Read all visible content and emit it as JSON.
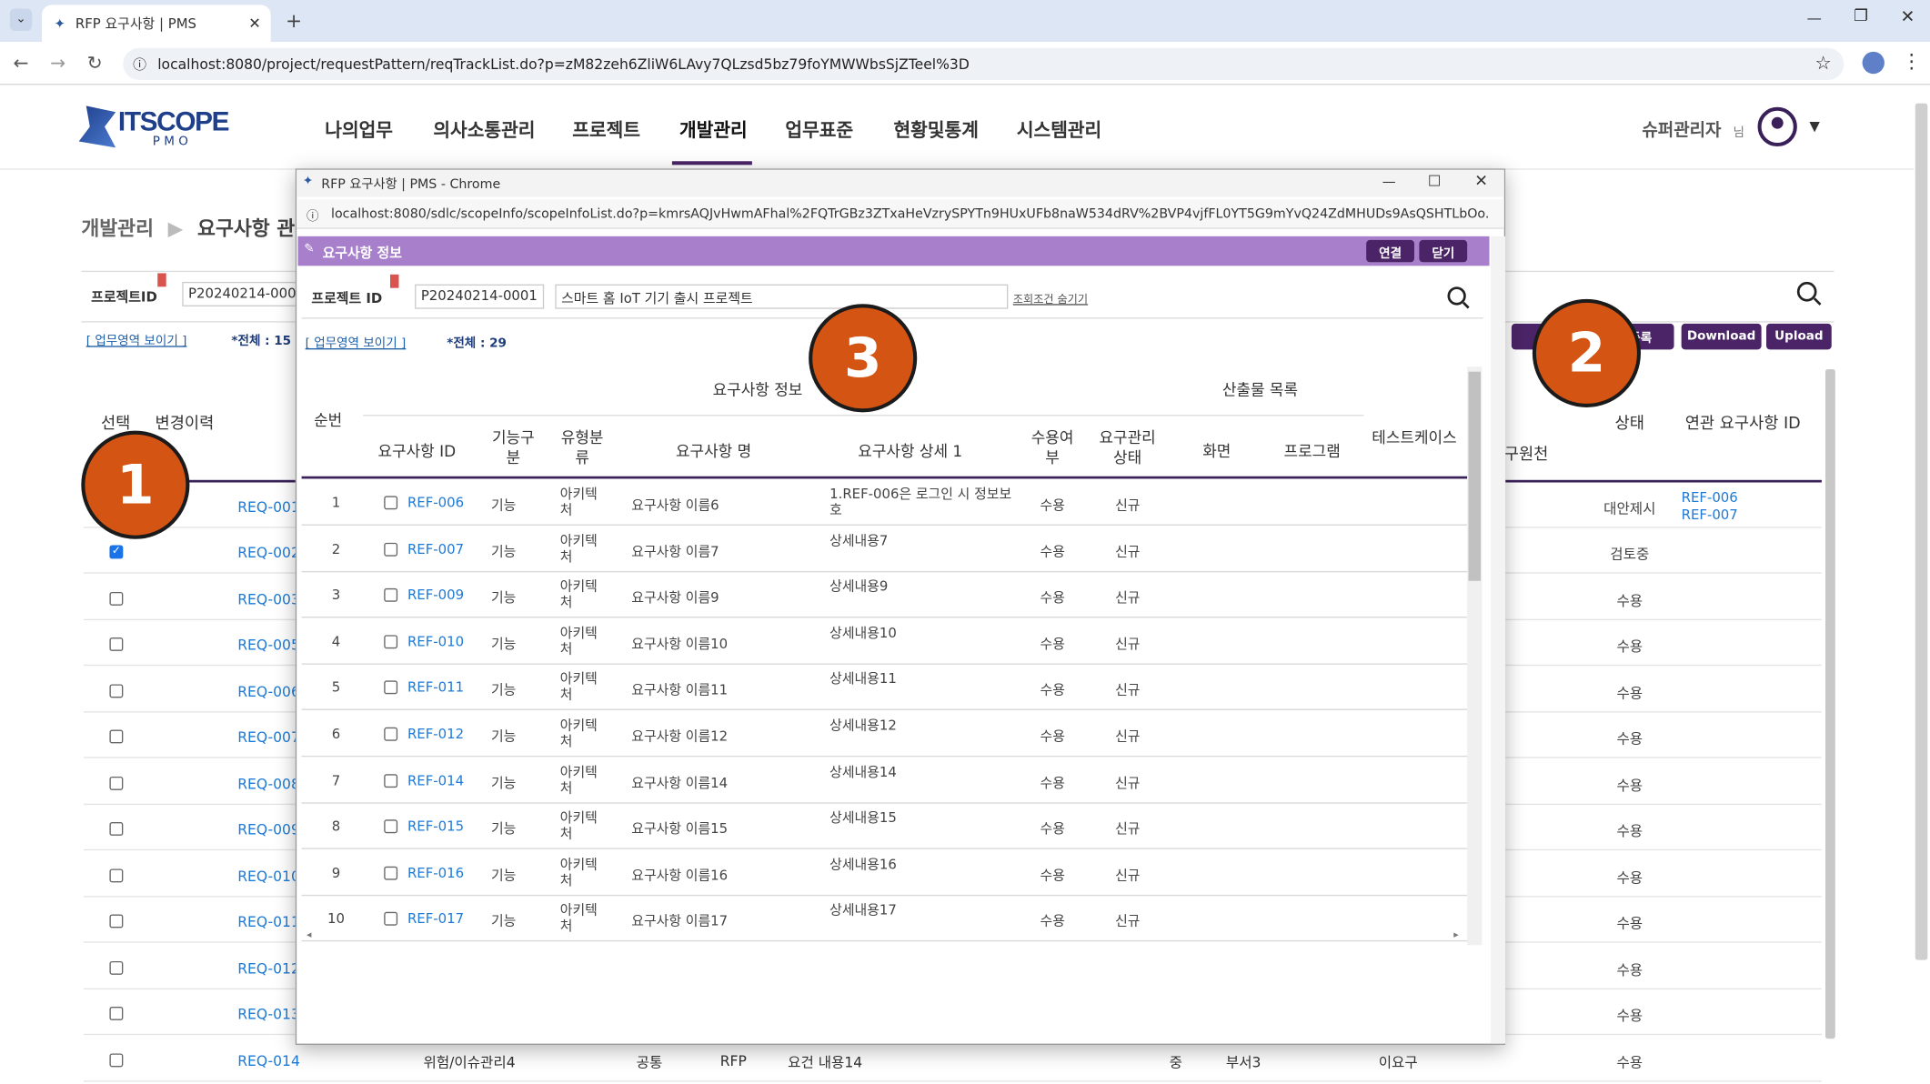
{
  "browser": {
    "tab_title": "RFP 요구사항 | PMS",
    "url": "localhost:8080/project/requestPattern/reqTrackList.do?p=zM82zeh6ZliW6LAvy7QLzsd5bz79foYMWWbsSjZTeel%3D"
  },
  "header": {
    "logo_main": "ITSCOPE",
    "logo_sub": "P M O",
    "menu": [
      "나의업무",
      "의사소통관리",
      "프로젝트",
      "개발관리",
      "업무표준",
      "현황및통계",
      "시스템관리"
    ],
    "user": "슈퍼관리자",
    "user_suffix": "님"
  },
  "page": {
    "breadcrumb_1": "개발관리",
    "breadcrumb_2": "요구사항 관",
    "project_label": "프로젝트ID",
    "project_value": "P20240214-0001",
    "toggle_link": "[ 업무영역 보이기 ]",
    "total": "*전체 : 15",
    "btn_register": "등록",
    "btn_download": "Download",
    "btn_upload": "Upload",
    "col_select": "선택",
    "col_history": "변경이력",
    "col_status": "상태",
    "col_related": "연관 요구사항 ID",
    "col_source": "구원천"
  },
  "rows": [
    {
      "id": "REQ-001",
      "checked": false,
      "status": "대안제시",
      "related": [
        "REF-006",
        "REF-007"
      ]
    },
    {
      "id": "REQ-002",
      "checked": true,
      "status": "검토중",
      "related": []
    },
    {
      "id": "REQ-003",
      "checked": false,
      "status": "수용",
      "related": []
    },
    {
      "id": "REQ-005",
      "checked": false,
      "status": "수용",
      "related": []
    },
    {
      "id": "REQ-006",
      "checked": false,
      "status": "수용",
      "related": []
    },
    {
      "id": "REQ-007",
      "checked": false,
      "status": "수용",
      "related": []
    },
    {
      "id": "REQ-008",
      "checked": false,
      "status": "수용",
      "related": []
    },
    {
      "id": "REQ-009",
      "checked": false,
      "status": "수용",
      "related": []
    },
    {
      "id": "REQ-010",
      "checked": false,
      "status": "수용",
      "related": []
    },
    {
      "id": "REQ-011",
      "checked": false,
      "status": "수용",
      "related": []
    },
    {
      "id": "REQ-012",
      "checked": false,
      "status": "수용",
      "related": []
    },
    {
      "id": "REQ-013",
      "checked": false,
      "status": "수용",
      "related": []
    },
    {
      "id": "REQ-014",
      "checked": false,
      "status": "수용",
      "related": []
    }
  ],
  "last_row": {
    "name": "위험/이슈관리4",
    "type": "공통",
    "source": "RFP",
    "content": "요건 내용14",
    "level": "중",
    "dept": "부서3",
    "owner": "이요구"
  },
  "popup": {
    "title": "RFP 요구사항 | PMS - Chrome",
    "url": "localhost:8080/sdlc/scopeInfo/scopeInfoList.do?p=kmrsAQJvHwmAFhal%2FQTrGBz3ZTxaHeVzrySPYTn9HUxUFb8naW534dRV%2BVP4vjfFL0YT5G9mYvQ24ZdMHUDs9AsQSHTLbOo...",
    "panel_title": "요구사항 정보",
    "btn_connect": "연결",
    "btn_close": "닫기",
    "project_label": "프로젝트 ID",
    "project_value": "P20240214-0001",
    "project_name": "스마트 홈 IoT 기기 출시 프로젝트",
    "search_hide": "조회조건 숨기기",
    "toggle_link": "[ 업무영역 보이기 ]",
    "total": "*전체 : 29",
    "group_req": "요구사항 정보",
    "group_out": "산출물 목록",
    "col_no": "순번",
    "col_id": "요구사항 ID",
    "col_func": "기능구분",
    "col_type": "유형분류",
    "col_name": "요구사항 명",
    "col_detail": "요구사항 상세 1",
    "col_accept": "수용여부",
    "col_state": "요구관리상태",
    "col_screen": "화면",
    "col_program": "프로그램",
    "col_test": "테스트케이스",
    "rows": [
      {
        "no": "1",
        "id": "REF-006",
        "func": "기능",
        "type": "아키텍처",
        "name": "요구사항 이름6",
        "detail": "1.REF-006은 로그인 시 정보보호",
        "accept": "수용",
        "state": "신규"
      },
      {
        "no": "2",
        "id": "REF-007",
        "func": "기능",
        "type": "아키텍처",
        "name": "요구사항 이름7",
        "detail": "상세내용7",
        "accept": "수용",
        "state": "신규"
      },
      {
        "no": "3",
        "id": "REF-009",
        "func": "기능",
        "type": "아키텍처",
        "name": "요구사항 이름9",
        "detail": "상세내용9",
        "accept": "수용",
        "state": "신규"
      },
      {
        "no": "4",
        "id": "REF-010",
        "func": "기능",
        "type": "아키텍처",
        "name": "요구사항 이름10",
        "detail": "상세내용10",
        "accept": "수용",
        "state": "신규"
      },
      {
        "no": "5",
        "id": "REF-011",
        "func": "기능",
        "type": "아키텍처",
        "name": "요구사항 이름11",
        "detail": "상세내용11",
        "accept": "수용",
        "state": "신규"
      },
      {
        "no": "6",
        "id": "REF-012",
        "func": "기능",
        "type": "아키텍처",
        "name": "요구사항 이름12",
        "detail": "상세내용12",
        "accept": "수용",
        "state": "신규"
      },
      {
        "no": "7",
        "id": "REF-014",
        "func": "기능",
        "type": "아키텍처",
        "name": "요구사항 이름14",
        "detail": "상세내용14",
        "accept": "수용",
        "state": "신규"
      },
      {
        "no": "8",
        "id": "REF-015",
        "func": "기능",
        "type": "아키텍처",
        "name": "요구사항 이름15",
        "detail": "상세내용15",
        "accept": "수용",
        "state": "신규"
      },
      {
        "no": "9",
        "id": "REF-016",
        "func": "기능",
        "type": "아키텍처",
        "name": "요구사항 이름16",
        "detail": "상세내용16",
        "accept": "수용",
        "state": "신규"
      },
      {
        "no": "10",
        "id": "REF-017",
        "func": "기능",
        "type": "아키텍처",
        "name": "요구사항 이름17",
        "detail": "상세내용17",
        "accept": "수용",
        "state": "신규"
      }
    ]
  },
  "markers": [
    "1",
    "2",
    "3"
  ],
  "colors": {
    "accent": "#4a2467",
    "popup_header": "#a77fcb",
    "marker": "#d35413",
    "link": "#1e7ad6"
  }
}
